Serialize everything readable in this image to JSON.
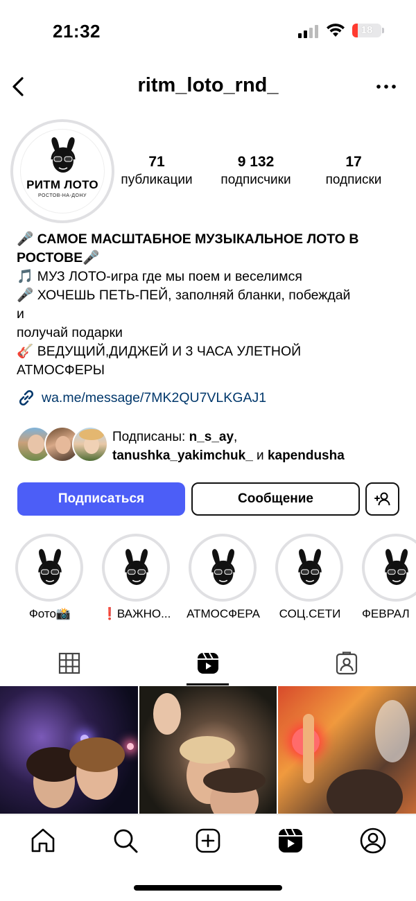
{
  "status_bar": {
    "time": "21:32",
    "battery": "18",
    "battery_level": 0.18,
    "battery_color": "#ff3b30"
  },
  "nav": {
    "username": "ritm_loto_rnd_"
  },
  "avatar": {
    "brand": "РИТМ ЛОТО",
    "subtitle": "РОСТОВ-НА-ДОНУ"
  },
  "stats": [
    {
      "value": "71",
      "label": "публикации"
    },
    {
      "value": "9 132",
      "label": "подписчики"
    },
    {
      "value": "17",
      "label": "подписки"
    }
  ],
  "bio": {
    "title": "🎤 САМОЕ МАСШТАБНОЕ МУЗЫКАЛЬНОЕ ЛОТО В РОСТОВЕ🎤",
    "line1": "🎵 МУЗ ЛОТО-игра где мы поем и веселимся",
    "line2": "🎤 ХОЧЕШЬ ПЕТЬ-ПЕЙ, заполняй бланки, побеждай",
    "line3": "и",
    "line4": "получай подарки",
    "line5": "🎸 ВЕДУЩИЙ,ДИДЖЕЙ И 3 ЧАСА УЛЕТНОЙ",
    "line6": "АТМОСФЕРЫ"
  },
  "link": {
    "text": "wa.me/message/7MK2QU7VLKGAJ1"
  },
  "followed_by": {
    "prefix": "Подписаны: ",
    "user1": "n_s_ay",
    "comma": ",",
    "user2": "tanushka_yakimchuk_",
    "and": " и ",
    "user3": "kapendusha"
  },
  "buttons": {
    "follow": "Подписаться",
    "message": "Сообщение"
  },
  "highlights": [
    {
      "label": "Фото📸"
    },
    {
      "label": "❗ВАЖНО..."
    },
    {
      "label": "АТМОСФЕРА"
    },
    {
      "label": "СОЦ.СЕТИ"
    },
    {
      "label": "ФЕВРАЛ"
    }
  ],
  "tabs": {
    "active": "reels"
  },
  "colors": {
    "accent": "#4c5ef7",
    "link": "#00376b",
    "ring": "#e0e0e3"
  }
}
